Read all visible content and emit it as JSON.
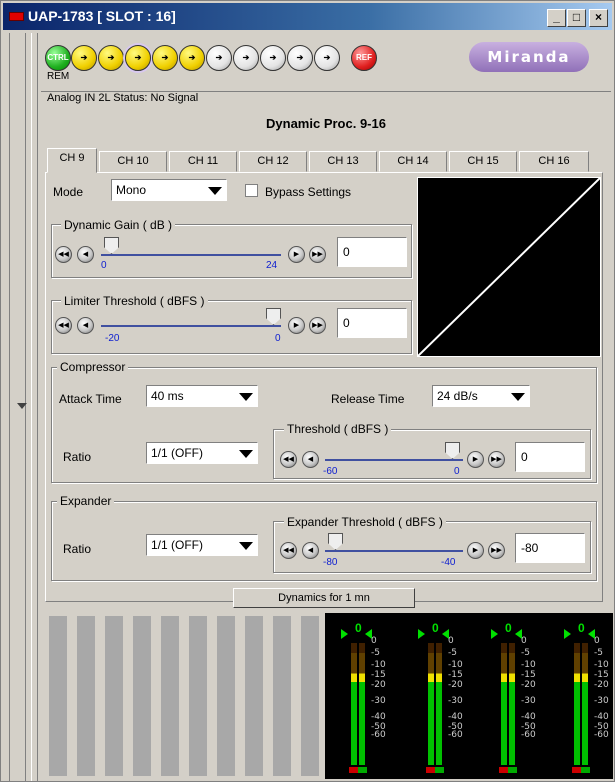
{
  "window": {
    "title": "UAP-1783 [ SLOT : 16]",
    "min": "_",
    "max": "□",
    "close": "×"
  },
  "toolbar": {
    "ctrl": "CTRL",
    "rem": "REM",
    "ref": "REF",
    "logo": "Miranda"
  },
  "status": {
    "text": "Analog IN 2L Status: No Signal"
  },
  "page": {
    "title": "Dynamic Proc. 9-16"
  },
  "tabs": [
    "CH 9",
    "CH 10",
    "CH 11",
    "CH 12",
    "CH 13",
    "CH 14",
    "CH 15",
    "CH 16"
  ],
  "mode": {
    "label": "Mode",
    "value": "Mono",
    "bypass": "Bypass Settings"
  },
  "gain": {
    "title": "Dynamic Gain ( dB )",
    "min": "0",
    "max": "24",
    "value": "0",
    "level": 0
  },
  "limiter": {
    "title": "Limiter Threshold ( dBFS )",
    "min": "-20",
    "max": "0",
    "value": "0",
    "level": 1
  },
  "compressor": {
    "title": "Compressor",
    "attack_label": "Attack Time",
    "attack_value": "40 ms",
    "release_label": "Release Time",
    "release_value": "24 dB/s",
    "ratio_label": "Ratio",
    "ratio_value": "1/1 (OFF)",
    "thr_title": "Threshold ( dBFS )",
    "thr_min": "-60",
    "thr_max": "0",
    "thr_value": "0",
    "thr_level": 1
  },
  "expander": {
    "title": "Expander",
    "ratio_label": "Ratio",
    "ratio_value": "1/1 (OFF)",
    "thr_title": "Expander Threshold ( dBFS )",
    "thr_min": "-80",
    "thr_max": "-40",
    "thr_value": "-80",
    "thr_level": 0
  },
  "dynamics_button": "Dynamics for 1 mn",
  "meters": {
    "top": "0",
    "scale": [
      "0",
      "-5",
      "-10",
      "-15",
      "-20",
      "-30",
      "-40",
      "-50",
      "-60"
    ]
  },
  "colors": {
    "accent": "#0a246a",
    "meter_green": "#00c000",
    "meter_yellow": "#f0e000"
  }
}
